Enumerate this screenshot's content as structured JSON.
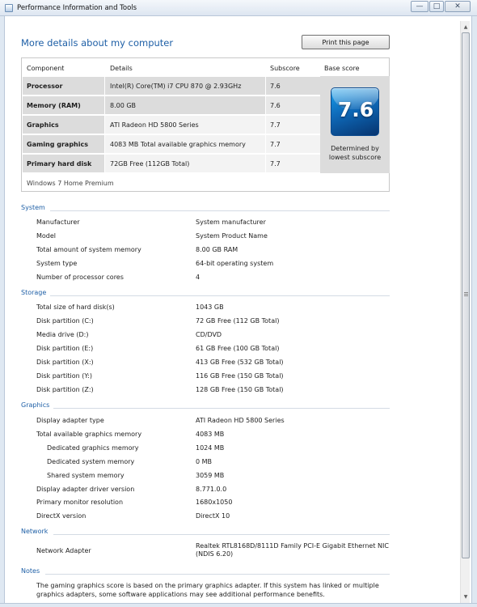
{
  "window": {
    "title": "Performance Information and Tools",
    "minimize_glyph": "—",
    "maximize_glyph": "□",
    "close_glyph": "✕"
  },
  "heading": "More details about my computer",
  "print_label": "Print this page",
  "score_table": {
    "headers": {
      "component": "Component",
      "details": "Details",
      "subscore": "Subscore",
      "base_score": "Base score"
    },
    "rows": [
      {
        "component": "Processor",
        "details": "Intel(R) Core(TM) i7 CPU 870 @ 2.93GHz",
        "subscore": "7.6"
      },
      {
        "component": "Memory (RAM)",
        "details": "8.00 GB",
        "subscore": "7.6"
      },
      {
        "component": "Graphics",
        "details": "ATI Radeon HD 5800 Series",
        "subscore": "7.7"
      },
      {
        "component": "Gaming graphics",
        "details": "4083 MB Total available graphics memory",
        "subscore": "7.7"
      },
      {
        "component": "Primary hard disk",
        "details": "72GB Free (112GB Total)",
        "subscore": "7.7"
      }
    ],
    "base_score": "7.6",
    "base_note": "Determined by lowest subscore",
    "os": "Windows 7 Home Premium",
    "badge_color": "#0e69b8"
  },
  "sections": {
    "system": {
      "title": "System",
      "items": [
        {
          "label": "Manufacturer",
          "value": "System manufacturer"
        },
        {
          "label": "Model",
          "value": "System Product Name"
        },
        {
          "label": "Total amount of system memory",
          "value": "8.00 GB RAM"
        },
        {
          "label": "System type",
          "value": "64-bit operating system"
        },
        {
          "label": "Number of processor cores",
          "value": "4"
        }
      ]
    },
    "storage": {
      "title": "Storage",
      "items": [
        {
          "label": "Total size of hard disk(s)",
          "value": "1043 GB"
        },
        {
          "label": "Disk partition (C:)",
          "value": "72 GB Free (112 GB Total)"
        },
        {
          "label": "Media drive (D:)",
          "value": "CD/DVD"
        },
        {
          "label": "Disk partition (E:)",
          "value": "61 GB Free (100 GB Total)"
        },
        {
          "label": "Disk partition (X:)",
          "value": "413 GB Free (532 GB Total)"
        },
        {
          "label": "Disk partition (Y:)",
          "value": "116 GB Free (150 GB Total)"
        },
        {
          "label": "Disk partition (Z:)",
          "value": "128 GB Free (150 GB Total)"
        }
      ]
    },
    "graphics": {
      "title": "Graphics",
      "items": [
        {
          "label": "Display adapter type",
          "value": "ATI Radeon HD 5800 Series"
        },
        {
          "label": "Total available graphics memory",
          "value": "4083 MB"
        },
        {
          "label": "Dedicated graphics memory",
          "value": "1024 MB"
        },
        {
          "label": "Dedicated system memory",
          "value": "0 MB"
        },
        {
          "label": "Shared system memory",
          "value": "3059 MB"
        },
        {
          "label": "Display adapter driver version",
          "value": "8.771.0.0"
        },
        {
          "label": "Primary monitor resolution",
          "value": "1680x1050"
        },
        {
          "label": "DirectX version",
          "value": "DirectX 10"
        }
      ]
    },
    "network": {
      "title": "Network",
      "items": [
        {
          "label": "Network Adapter",
          "value": "Realtek RTL8168D/8111D Family PCI-E Gigabit Ethernet NIC (NDIS 6.20)"
        }
      ]
    },
    "notes": {
      "title": "Notes",
      "text_line1": "The gaming graphics score is based on the primary graphics adapter. If this system has linked or multiple",
      "text_line2": "graphics adapters, some software applications may see additional performance benefits."
    }
  },
  "colors": {
    "link_blue": "#1e5fa6",
    "row_shade": "#dcdcdc",
    "row_light": "#f3f3f3"
  }
}
